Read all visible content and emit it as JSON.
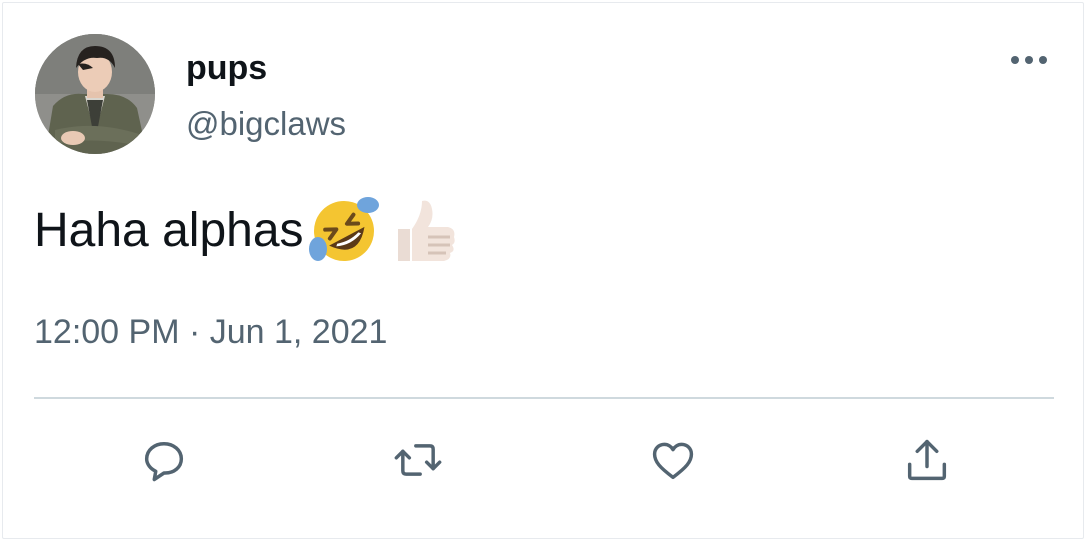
{
  "tweet": {
    "author": {
      "display_name": "pups",
      "handle": "@bigclaws",
      "avatar_icon": "profile-photo"
    },
    "text": "Haha alphas",
    "emojis": [
      "rolling-on-the-floor-laughing-emoji",
      "thumbs-up-light-skin-tone-emoji"
    ],
    "timestamp": "12:00 PM · Jun 1, 2021"
  },
  "actions": [
    {
      "name": "reply",
      "icon": "reply-bubble-icon"
    },
    {
      "name": "retweet",
      "icon": "retweet-icon"
    },
    {
      "name": "like",
      "icon": "heart-icon"
    },
    {
      "name": "share",
      "icon": "share-icon"
    }
  ],
  "colors": {
    "primary_text": "#0f1419",
    "secondary_text": "#536471",
    "divider": "#cfd9de",
    "background": "#ffffff"
  }
}
